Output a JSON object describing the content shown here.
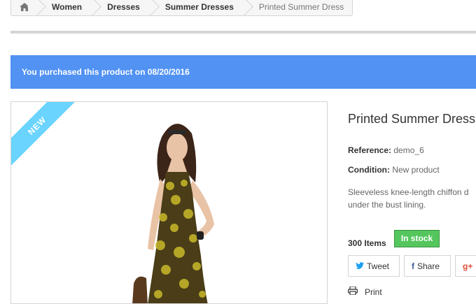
{
  "breadcrumb": {
    "home_icon": "home-icon",
    "items": [
      "Women",
      "Dresses",
      "Summer Dresses"
    ],
    "current": "Printed Summer Dress"
  },
  "banner": {
    "text": "You purchased this product on 08/20/2016"
  },
  "image": {
    "badge": "NEW"
  },
  "product": {
    "title": "Printed Summer Dress",
    "reference_label": "Reference:",
    "reference_value": "demo_6",
    "condition_label": "Condition:",
    "condition_value": "New product",
    "description_line1": "Sleeveless knee-length chiffon d",
    "description_line2": "under the bust lining.",
    "quantity": "300 Items",
    "stock": "In stock"
  },
  "social": {
    "tweet": "Tweet",
    "share": "Share",
    "google": "G"
  },
  "actions": {
    "print": "Print"
  },
  "colors": {
    "banner": "#5192f3",
    "stock": "#55c65e",
    "ribbon": "#6ad4ff"
  }
}
